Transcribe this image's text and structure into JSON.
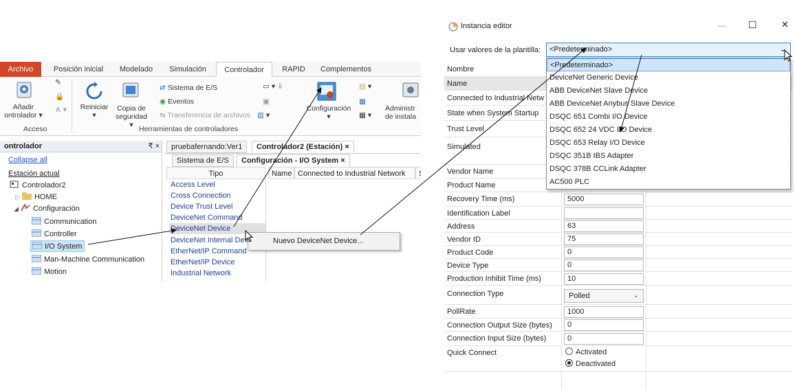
{
  "ribbon": {
    "tabs": [
      "Archivo",
      "Posición inicial",
      "Modelado",
      "Simulación",
      "Controlador",
      "RAPID",
      "Complementos"
    ],
    "add_controller": [
      "Añadir",
      "ontrolador"
    ],
    "restart": "Reiniciar",
    "backup": [
      "Copia de",
      "seguridad"
    ],
    "io_system": "Sistema de E/S",
    "events": "Eventos",
    "file_transfer": "Transferencia de archivos",
    "configuration": "Configuración",
    "admin": [
      "Administr",
      "de instala"
    ],
    "group_access": "Acceso",
    "group_tools": "Herramientas de controladores"
  },
  "controller_panel": {
    "title": "ontrolador",
    "pin": "₹ ×",
    "collapse_all": "Collapse all",
    "station": "Estación actual",
    "controller": "Controlador2",
    "home": "HOME",
    "configuration": "Configuración",
    "items": [
      "Communication",
      "Controller",
      "I/O System",
      "Man-Machine Communication",
      "Motion"
    ]
  },
  "doc": {
    "tabs": [
      "pruebafernando:Ver1",
      "Controlador2 (Estación) ×"
    ],
    "subtabs": [
      "Sistema de E/S",
      "Configuración - I/O System ×"
    ],
    "tipo_header": "Tipo",
    "name_header": "Name",
    "network_header": "Connected to Industrial Network",
    "extra_header": "S",
    "tipo_items": [
      "Access Level",
      "Cross Connection",
      "Device Trust Level",
      "DeviceNet Command",
      "DeviceNet Device",
      "DeviceNet Internal Dev",
      "EtherNet/IP Command",
      "EtherNet/IP Device",
      "Industrial Network"
    ]
  },
  "context_menu": {
    "item": "Nuevo DeviceNet Device..."
  },
  "editor": {
    "title": "Instancia editor",
    "minimize": "—",
    "maximize": "☐",
    "close": "✕",
    "template_label": "Usar valores de la plantilla:",
    "template_value": "<Predeterminado>",
    "dropdown_options": [
      "<Predeterminado>",
      "DeviceNet Generic Device",
      "ABB DeviceNet Slave Device",
      "ABB DeviceNet Anybus Slave Device",
      "DSQC 651 Combi I/O Device",
      "DSQC 652 24 VDC I/O Device",
      "DSQC 653 Relay I/O Device",
      "DSQC 351B IBS Adapter",
      "DSQC 378B CCLink Adapter",
      "AC500 PLC"
    ],
    "header_label": "Nombre",
    "properties": [
      {
        "label": "Name",
        "value": ""
      },
      {
        "label": "Connected to Industrial Netw",
        "value": ""
      },
      {
        "label": "State when System Startup",
        "value": ""
      },
      {
        "label": "Trust Level",
        "value": ""
      },
      {
        "label": "Simulated",
        "value": ""
      },
      {
        "label": "Vendor Name",
        "value": ""
      },
      {
        "label": "Product Name",
        "value": ""
      },
      {
        "label": "Recovery Time (ms)",
        "value": "5000"
      },
      {
        "label": "Identification Label",
        "value": ""
      },
      {
        "label": "Address",
        "value": "63"
      },
      {
        "label": "Vendor ID",
        "value": "75"
      },
      {
        "label": "Product Code",
        "value": "0"
      },
      {
        "label": "Device Type",
        "value": "0"
      },
      {
        "label": "Production Inhibit Time (ms)",
        "value": "10"
      },
      {
        "label": "Connection Type",
        "value": "Polled"
      },
      {
        "label": "PollRate",
        "value": "1000"
      },
      {
        "label": "Connection Output Size (bytes)",
        "value": "0"
      },
      {
        "label": "Connection Input Size (bytes)",
        "value": "0"
      },
      {
        "label": "Quick Connect",
        "value": ""
      }
    ],
    "quick_connect_options": [
      "Activated",
      "Deactivated"
    ],
    "quick_connect_selected": "Deactivated",
    "chevron": "⌄"
  },
  "colors": {
    "file_tab": "#d24726",
    "selection": "#cde4f7",
    "highlight": "#cfe5fb",
    "link": "#1a56c8"
  }
}
